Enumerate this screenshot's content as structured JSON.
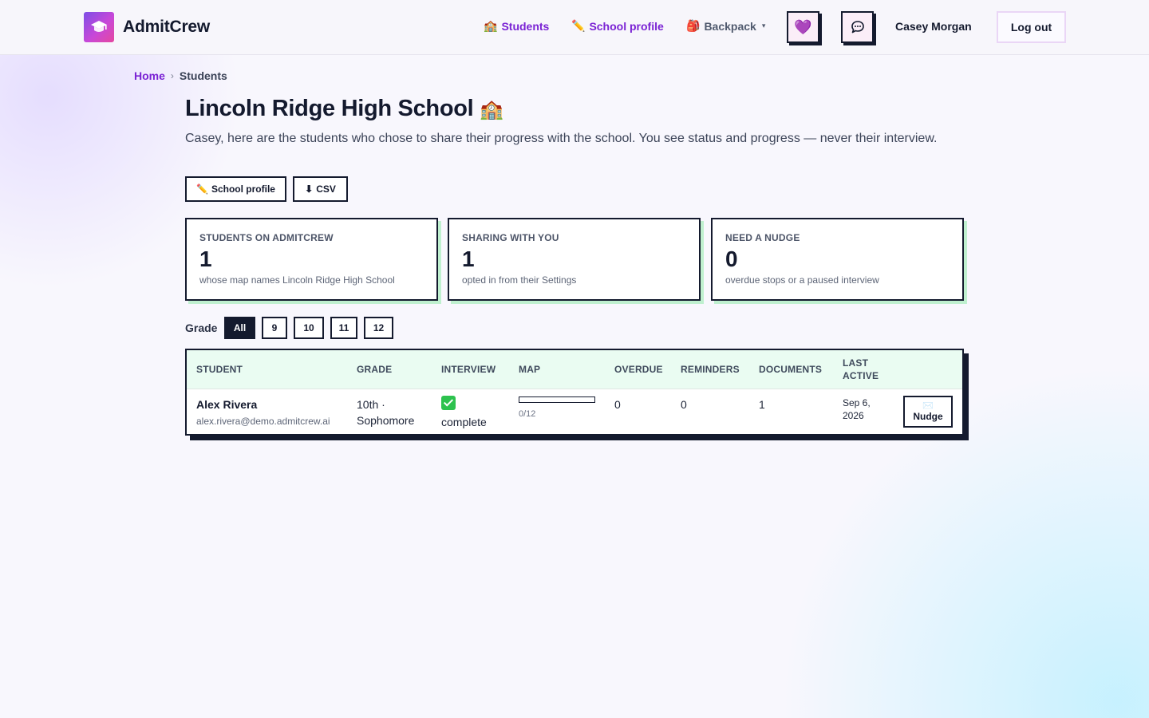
{
  "brand": {
    "name": "AdmitCrew"
  },
  "nav": {
    "students_icon": "🏫",
    "students": "Students",
    "school_profile_icon": "✏️",
    "school_profile": "School profile",
    "backpack_icon": "🎒",
    "backpack": "Backpack",
    "heart": "💜",
    "user": "Casey Morgan",
    "logout": "Log out"
  },
  "breadcrumb": {
    "home": "Home",
    "sep": "›",
    "current": "Students"
  },
  "page": {
    "title": "Lincoln Ridge High School",
    "title_icon": "🏫",
    "subtitle": "Casey, here are the students who chose to share their progress with the school. You see status and progress — never their interview."
  },
  "actions": {
    "profile_icon": "✏️",
    "profile": "School profile",
    "csv_icon": "⬇",
    "csv": "CSV"
  },
  "stats": [
    {
      "label": "STUDENTS ON ADMITCREW",
      "value": "1",
      "note": "whose map names Lincoln Ridge High School"
    },
    {
      "label": "SHARING WITH YOU",
      "value": "1",
      "note": "opted in from their Settings"
    },
    {
      "label": "NEED A NUDGE",
      "value": "0",
      "note": "overdue stops or a paused interview"
    }
  ],
  "grade_filter": {
    "label": "Grade",
    "options": [
      "All",
      "9",
      "10",
      "11",
      "12"
    ],
    "selected": "All"
  },
  "table": {
    "headers": {
      "student": "STUDENT",
      "grade": "GRADE",
      "interview": "INTERVIEW",
      "map": "MAP",
      "overdue": "OVERDUE",
      "reminders": "REMINDERS",
      "documents": "DOCUMENTS",
      "last_active_1": "LAST",
      "last_active_2": "ACTIVE"
    },
    "rows": [
      {
        "name": "Alex Rivera",
        "email": "alex.rivera@demo.admitcrew.ai",
        "grade_1": "10th ·",
        "grade_2": "Sophomore",
        "interview": "complete",
        "map_done": 0,
        "map_total": 12,
        "map_text": "0/12",
        "overdue": "0",
        "reminders": "0",
        "documents": "1",
        "last_active_1": "Sep 6,",
        "last_active_2": "2026",
        "nudge_icon": "✉️",
        "nudge": "Nudge"
      }
    ]
  },
  "colors": {
    "accent": "#7a22d4",
    "ink": "#141a2e",
    "mint": "#bff0cf",
    "header_mint": "#eafcf2"
  }
}
